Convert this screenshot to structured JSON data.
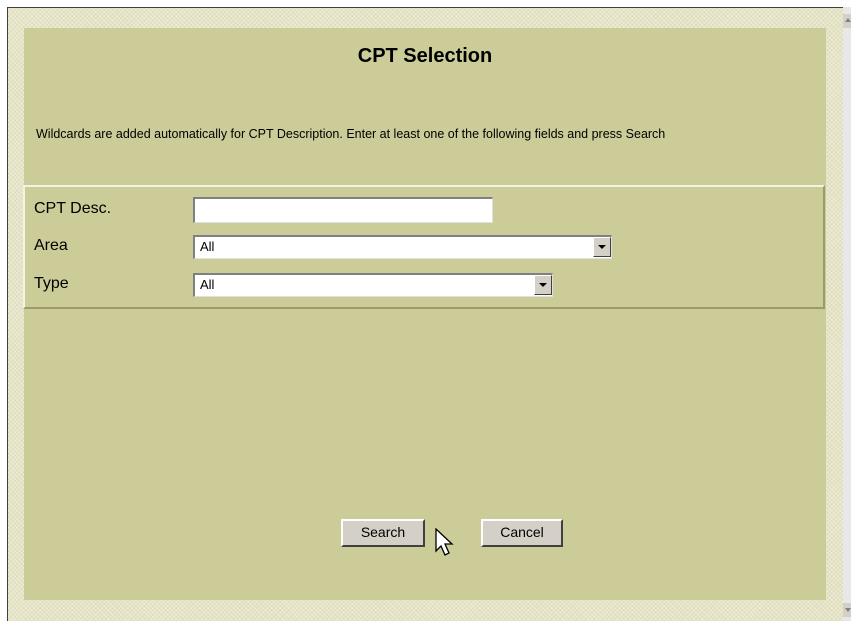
{
  "dialog": {
    "title": "CPT Selection",
    "instructions": "Wildcards are added automatically for CPT Description. Enter at least one of the following fields and press Search"
  },
  "fields": {
    "cpt_desc": {
      "label": "CPT Desc.",
      "value": ""
    },
    "area": {
      "label": "Area",
      "selected": "All"
    },
    "type": {
      "label": "Type",
      "selected": "All"
    }
  },
  "buttons": {
    "search_label": "Search",
    "cancel_label": "Cancel"
  },
  "icons": {
    "dropdown": "chevron-down-icon",
    "cursor": "mouse-pointer-icon",
    "scroll_up": "scroll-up-arrow-icon",
    "scroll_down": "scroll-down-arrow-icon"
  },
  "colors": {
    "panel_background": "#cccc99",
    "frame_background": "#e6e4c6",
    "button_face": "#d4d0c8"
  }
}
